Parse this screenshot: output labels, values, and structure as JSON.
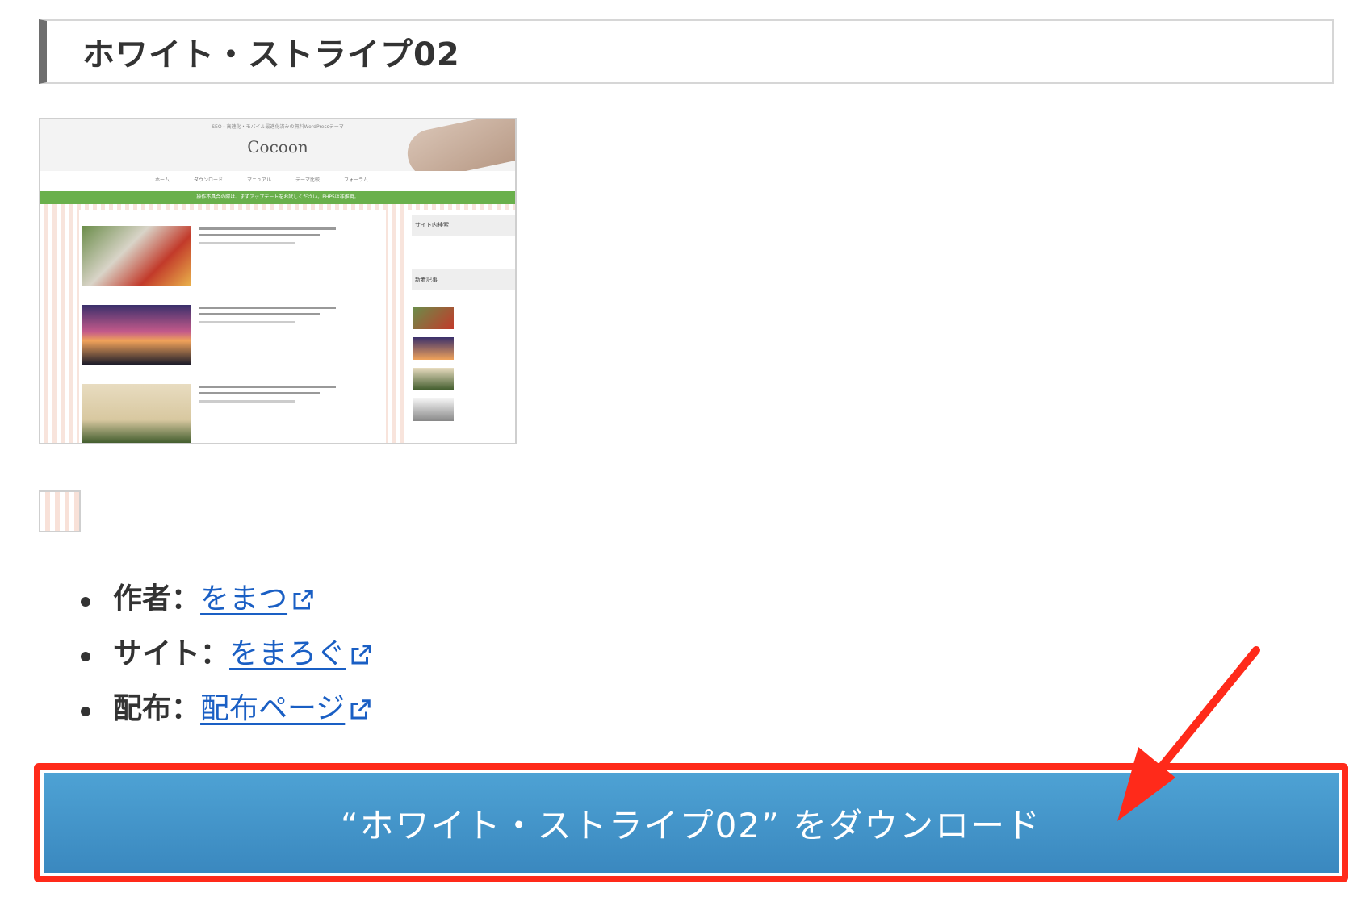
{
  "heading": {
    "title": "ホワイト・ストライプ02"
  },
  "preview": {
    "tagline": "SEO・高速化・モバイル最適化済みの無料WordPressテーマ",
    "logo": "Cocoon",
    "nav": [
      "ホーム",
      "ダウンロード",
      "マニュアル",
      "テーマ比較",
      "フォーラム"
    ],
    "notice": "操作不具合の際は、まずアップデートをお試しください。PHP5は非推奨。",
    "sidebar": {
      "search_title": "サイト内検索",
      "recent_title": "新着記事"
    },
    "accent": "#6ab04c"
  },
  "info": [
    {
      "label": "作者",
      "sep": "：",
      "link": "をまつ",
      "icon": "external-link-icon"
    },
    {
      "label": "サイト",
      "sep": "：",
      "link": "をまろぐ",
      "icon": "external-link-icon"
    },
    {
      "label": "配布",
      "sep": "：",
      "link": "配布ページ",
      "icon": "external-link-icon"
    }
  ],
  "download": {
    "label": "“ホワイト・ストライプ02” をダウンロード",
    "color": "#4a9dd0",
    "highlight": "#ff2a1a"
  }
}
